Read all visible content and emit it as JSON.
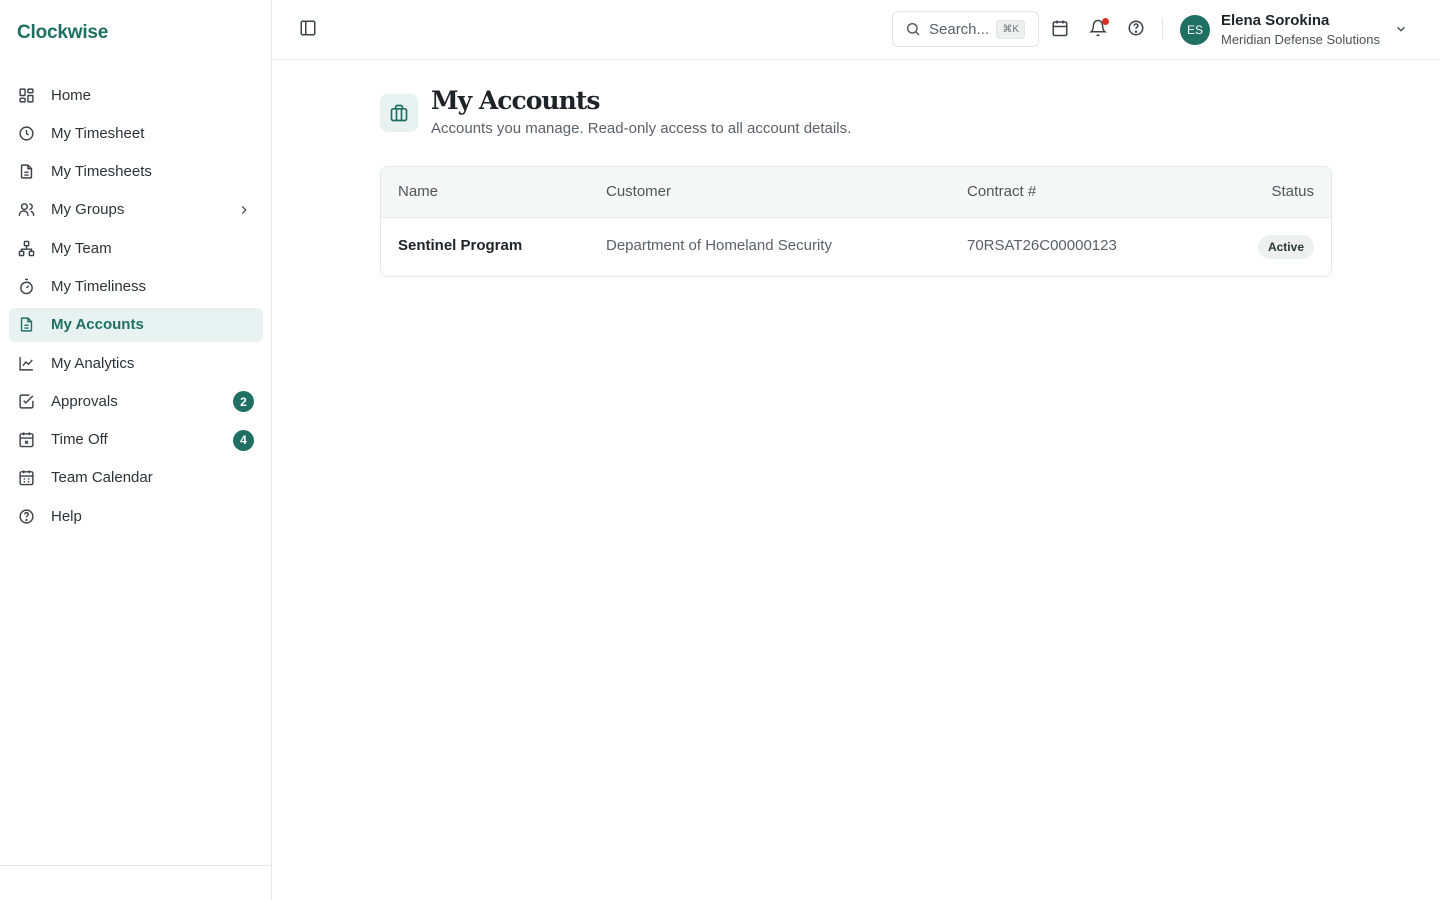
{
  "app": {
    "brand": "Clockwise"
  },
  "sidebar": {
    "items": [
      {
        "label": "Home",
        "icon": "dashboard-grid-icon"
      },
      {
        "label": "My Timesheet",
        "icon": "clock-icon"
      },
      {
        "label": "My Timesheets",
        "icon": "document-icon"
      },
      {
        "label": "My Groups",
        "icon": "users-icon",
        "expandable": true
      },
      {
        "label": "My Team",
        "icon": "org-chart-icon"
      },
      {
        "label": "My Timeliness",
        "icon": "stopwatch-icon"
      },
      {
        "label": "My Accounts",
        "icon": "document-icon",
        "active": true
      },
      {
        "label": "My Analytics",
        "icon": "line-chart-icon"
      },
      {
        "label": "Approvals",
        "icon": "checkbox-icon",
        "badge": "2"
      },
      {
        "label": "Time Off",
        "icon": "calendar-x-icon",
        "badge": "4"
      },
      {
        "label": "Team Calendar",
        "icon": "calendar-icon"
      },
      {
        "label": "Help",
        "icon": "help-circle-icon"
      }
    ]
  },
  "topbar": {
    "search_placeholder": "Search...",
    "search_shortcut": "⌘K",
    "user": {
      "initials": "ES",
      "name": "Elena Sorokina",
      "org": "Meridian Defense Solutions"
    }
  },
  "page": {
    "title": "My Accounts",
    "subtitle": "Accounts you manage. Read-only access to all account details."
  },
  "table": {
    "columns": [
      "Name",
      "Customer",
      "Contract #",
      "Status"
    ],
    "rows": [
      {
        "name": "Sentinel Program",
        "customer": "Department of Homeland Security",
        "contract": "70RSAT26C00000123",
        "status": "Active"
      }
    ]
  },
  "colors": {
    "accent": "#1f6f63",
    "accent_soft": "#e8f3f1",
    "notification_dot": "#d93025"
  }
}
